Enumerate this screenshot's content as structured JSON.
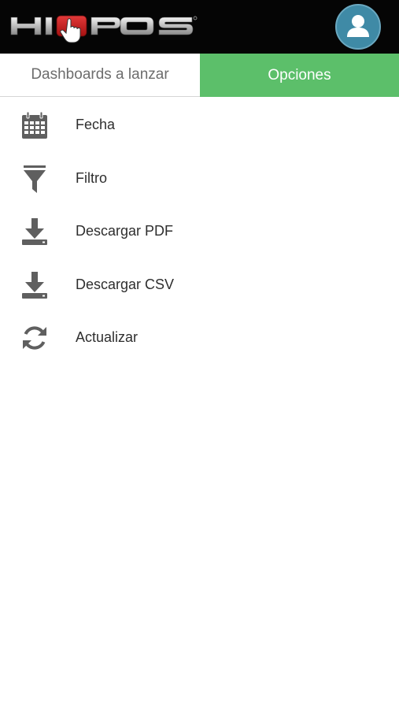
{
  "header": {
    "logo_text": "HIPOS",
    "logo_icon": "hand-pointer-icon",
    "avatar_icon": "user-icon"
  },
  "tabs": [
    {
      "label": "Dashboards a lanzar",
      "active": false
    },
    {
      "label": "Opciones",
      "active": true
    }
  ],
  "menu": {
    "items": [
      {
        "label": "Fecha",
        "icon": "calendar-icon"
      },
      {
        "label": "Filtro",
        "icon": "funnel-icon"
      },
      {
        "label": "Descargar PDF",
        "icon": "download-icon"
      },
      {
        "label": "Descargar CSV",
        "icon": "download-icon"
      },
      {
        "label": "Actualizar",
        "icon": "refresh-icon"
      }
    ]
  },
  "colors": {
    "header_bg": "#050505",
    "active_tab": "#5cbf6a",
    "icon_gray": "#5f5f5f",
    "avatar_bg": "#3f8aa6"
  }
}
